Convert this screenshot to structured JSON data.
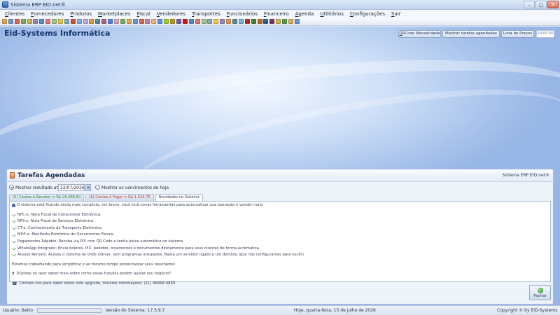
{
  "window": {
    "title": "Sistema ERP EID.net®",
    "min": "–",
    "max": "□",
    "close": "✕"
  },
  "menu": [
    {
      "first": "C",
      "rest": "lientes"
    },
    {
      "first": "F",
      "rest": "ornecedores"
    },
    {
      "first": "P",
      "rest": "rodutos"
    },
    {
      "first": "M",
      "rest": "arketplaces"
    },
    {
      "first": "F",
      "rest": "iscal"
    },
    {
      "first": "V",
      "rest": "endedores"
    },
    {
      "first": "T",
      "rest": "ransportes"
    },
    {
      "first": "F",
      "rest": "uncionários"
    },
    {
      "first": "F",
      "rest": "inanceiro"
    },
    {
      "first": "A",
      "rest": "genda"
    },
    {
      "first": "U",
      "rest": "tilitários"
    },
    {
      "first": "C",
      "rest": "onfigurações"
    },
    {
      "first": "S",
      "rest": "air"
    }
  ],
  "toolbar_colors": [
    "#e3a23a",
    "#5b8fd6",
    "#d9553f",
    "#6aa84f",
    "#c9b037",
    "#8e7cc3",
    "#3d85c6",
    "#e06666",
    "#93c47d",
    "#f1c232",
    "#76a5af",
    "#cc4125",
    "#6fa8dc",
    "#b4a7d6",
    "#e69138",
    "#45818e",
    "#a64d79",
    "#3c78d8",
    "#d5a6bd",
    "#6aa84f",
    "#e3a23a",
    "#5b8fd6",
    "#d9553f",
    "#c27ba0",
    "#f6b26b",
    "#4a86e8",
    "#8fce00",
    "#bf9000",
    "#674ea7",
    "#cc0000",
    "#3d85c6",
    "#e06666",
    "#93c47d",
    "#76a5af",
    "#f1c232",
    "#8e7cc3",
    "#e69138",
    "#45818e",
    "#6fa8dc",
    "#a61c00",
    "#38761d",
    "#b45f06",
    "#0b5394",
    "#741b47",
    "#c9b037",
    "#3a9a2f",
    "#e3a23a",
    "#5b8fd6"
  ],
  "header": {
    "company": "Eid-Systems Informática",
    "btn_qrcode": {
      "first": "Q",
      "rest": "RCode Mensalidade"
    },
    "btn_tarefas": "Mostrar tarefas agendadas",
    "btn_lista": "Lista de Preços",
    "clock": "19:00:00"
  },
  "panel": {
    "title": "Tarefas Agendadas",
    "brand": "Sistema ERP EID.net®",
    "radio_until": "Mostrar resultado até",
    "date_value": "22/07/2026",
    "radio_expiry": "Mostrar os vencimentos de hoje",
    "tabs": [
      "(5) Contas à Receber = R$ 28.488,60",
      "(6) Contas à Pagar = R$ 1.523,75",
      "Novidades no Sistema"
    ],
    "news_intro": "O sistema está ficando ainda mais completo, em breve, você terá novas ferramentas para automatizar sua operação e vender mais:",
    "news_items": [
      "NFC-e: Nota Fiscal de Consumidor Eletrônica.",
      "NFS-e: Nota Fiscal de Serviços Eletrônica.",
      "CT-e: Conhecimento de Transporte Eletrônico.",
      "MDF-e: Manifesto Eletrônico de Documentos Fiscais.",
      "Pagamentos Rápidos: Receba via PIX com QR Code e tenha baixa automática no sistema.",
      "WhatsApp Integrado: Envie boletos, PIX, pedidos, orçamentos e documentos diretamente para seus clientes de forma automática.",
      "Acesso Remoto: Acesse o sistema de onde estiver, sem programas instalados. Basta um servidor ligado e um domínio (que nós configuramos para você!)."
    ],
    "news_working": "Estamos trabalhando para simplificar e ao mesmo tempo potencializar seus resultados!",
    "news_question": "Dúvidas ou quer saber mais sobre como essas funções podem ajudar seu negócio?",
    "news_contact": "Contate-nos para saber sobre este upgrade, maiores informações: (11) 96868-9869",
    "close_button": "Fechar"
  },
  "status": {
    "user": "Usuário: Betto",
    "version": "Versão do Sistema: 17.5.9.7",
    "date": "Hoje, quarta-feira, 15 de julho de 2026",
    "copyright": "Copyright © by EID-Systems"
  }
}
